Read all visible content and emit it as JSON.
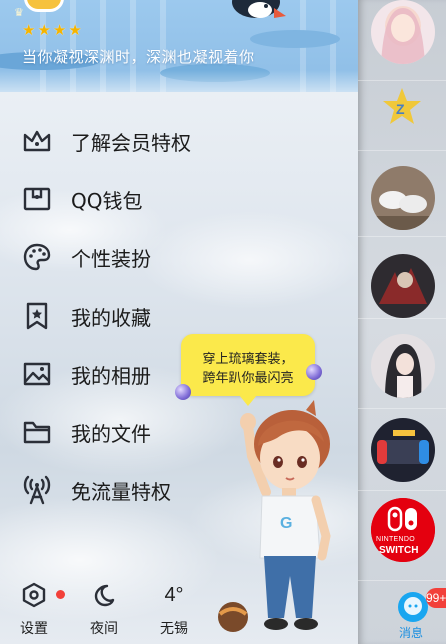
{
  "header": {
    "signature": "当你凝视深渊时，深渊也凝视着你",
    "star_count": 4
  },
  "menu": {
    "items": [
      {
        "label": "了解会员特权",
        "icon": "crown-icon"
      },
      {
        "label": "QQ钱包",
        "icon": "wallet-icon"
      },
      {
        "label": "个性装扮",
        "icon": "palette-icon"
      },
      {
        "label": "我的收藏",
        "icon": "bookmark-star-icon"
      },
      {
        "label": "我的相册",
        "icon": "photo-album-icon"
      },
      {
        "label": "我的文件",
        "icon": "folder-icon"
      },
      {
        "label": "免流量特权",
        "icon": "signal-tower-icon"
      }
    ]
  },
  "promo": {
    "line1": "穿上琉璃套装，",
    "line2": "跨年趴你最闪亮"
  },
  "bottom_bar": {
    "settings_label": "设置",
    "night_label": "夜间",
    "weather_temp": "4°",
    "weather_city": "无锡"
  },
  "contacts": {
    "switch_text_top": "NINTENDO",
    "switch_text_bottom": "SWITCH",
    "message_label": "消息",
    "message_badge": "99+"
  },
  "colors": {
    "accent": "#19a6f0",
    "badge_red": "#f2403a",
    "bubble_yellow": "#fbe94b",
    "switch_red": "#e4000f"
  }
}
